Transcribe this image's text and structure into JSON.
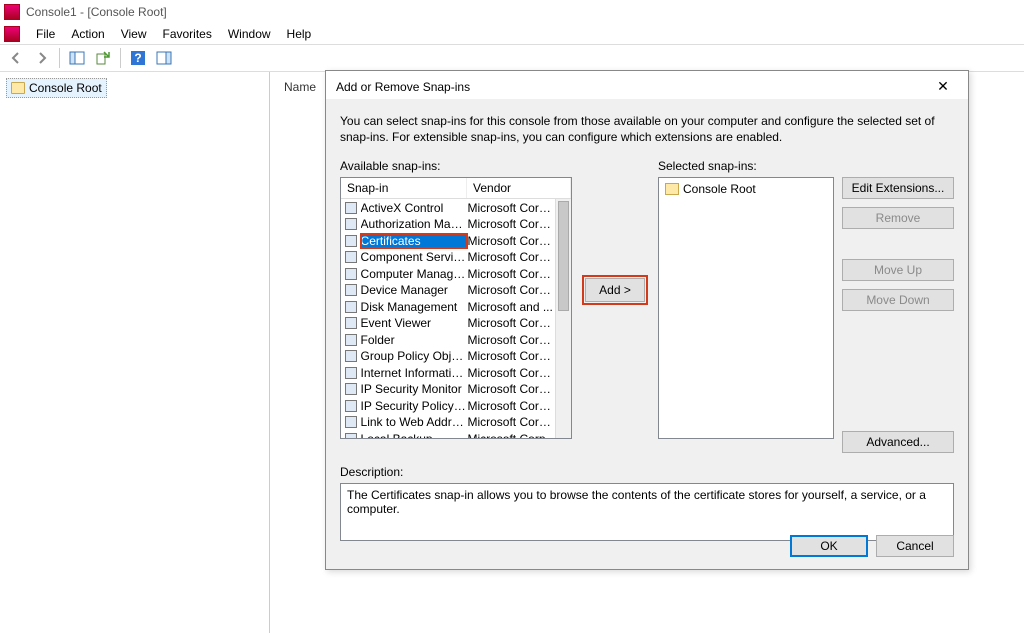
{
  "window": {
    "title": "Console1 - [Console Root]"
  },
  "menu": {
    "file": "File",
    "action": "Action",
    "view": "View",
    "favorites": "Favorites",
    "window": "Window",
    "help": "Help"
  },
  "tree": {
    "root": "Console Root"
  },
  "list": {
    "col_name": "Name"
  },
  "dialog": {
    "title": "Add or Remove Snap-ins",
    "intro": "You can select snap-ins for this console from those available on your computer and configure the selected set of snap-ins. For extensible snap-ins, you can configure which extensions are enabled.",
    "available_label": "Available snap-ins:",
    "selected_label": "Selected snap-ins:",
    "header_snapin": "Snap-in",
    "header_vendor": "Vendor",
    "add_btn": "Add >",
    "edit_ext": "Edit Extensions...",
    "remove": "Remove",
    "move_up": "Move Up",
    "move_down": "Move Down",
    "advanced": "Advanced...",
    "desc_label": "Description:",
    "desc_text": "The Certificates snap-in allows you to browse the contents of the certificate stores for yourself, a service, or a computer.",
    "ok": "OK",
    "cancel": "Cancel",
    "selected_root": "Console Root",
    "snapins": [
      {
        "name": "ActiveX Control",
        "vendor": "Microsoft Corp..."
      },
      {
        "name": "Authorization Manager",
        "vendor": "Microsoft Corp..."
      },
      {
        "name": "Certificates",
        "vendor": "Microsoft Corp...",
        "selected": true,
        "highlighted": true
      },
      {
        "name": "Component Services",
        "vendor": "Microsoft Corp..."
      },
      {
        "name": "Computer Managem...",
        "vendor": "Microsoft Corp..."
      },
      {
        "name": "Device Manager",
        "vendor": "Microsoft Corp..."
      },
      {
        "name": "Disk Management",
        "vendor": "Microsoft and ..."
      },
      {
        "name": "Event Viewer",
        "vendor": "Microsoft Corp..."
      },
      {
        "name": "Folder",
        "vendor": "Microsoft Corp..."
      },
      {
        "name": "Group Policy Object ...",
        "vendor": "Microsoft Corp..."
      },
      {
        "name": "Internet Information ...",
        "vendor": "Microsoft Corp..."
      },
      {
        "name": "IP Security Monitor",
        "vendor": "Microsoft Corp..."
      },
      {
        "name": "IP Security Policy Ma...",
        "vendor": "Microsoft Corp..."
      },
      {
        "name": "Link to Web Address",
        "vendor": "Microsoft Corp..."
      },
      {
        "name": "Local Backup",
        "vendor": "Microsoft Corp"
      }
    ]
  }
}
